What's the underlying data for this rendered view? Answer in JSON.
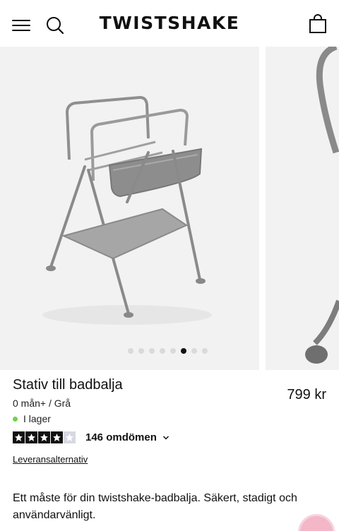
{
  "header": {
    "logo": "TWISTSHAKE",
    "menu_icon": "hamburger-menu-icon",
    "search_icon": "search-icon",
    "cart_icon": "shopping-bag-icon"
  },
  "gallery": {
    "image_count": 8,
    "active_index": 5
  },
  "product": {
    "title": "Stativ till badbalja",
    "price": "799 kr",
    "variant": "0 mån+ / Grå",
    "stock": "I lager",
    "stock_color": "#6fd34a",
    "rating": 4,
    "rating_max": 5,
    "reviews": "146 omdömen",
    "delivery_link": "Leveransalternativ",
    "description": "Ett måste för din twistshake-badbalja. Säkert, stadigt och användarvänligt."
  },
  "colors": {
    "accent_badge": "#f3b7c8"
  }
}
